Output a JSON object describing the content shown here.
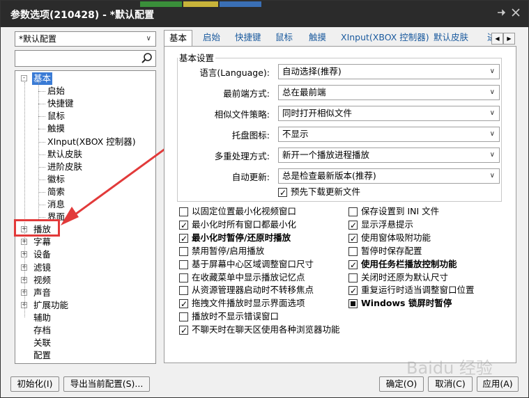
{
  "window": {
    "title": "参数选项(210428) - *默认配置",
    "pin_icon": "pin-icon",
    "close_icon": "close-icon"
  },
  "sidebar": {
    "profile": "*默认配置",
    "search_placeholder": "",
    "tree": [
      {
        "label": "基本",
        "expander": "-",
        "selected": true
      },
      {
        "label": "启始",
        "child": true
      },
      {
        "label": "快捷键",
        "child": true
      },
      {
        "label": "鼠标",
        "child": true
      },
      {
        "label": "触摸",
        "child": true
      },
      {
        "label": "XInput(XBOX 控制器)",
        "child": true
      },
      {
        "label": "默认皮肤",
        "child": true
      },
      {
        "label": "进阶皮肤",
        "child": true
      },
      {
        "label": "徽标",
        "child": true
      },
      {
        "label": "简索",
        "child": true
      },
      {
        "label": "消息",
        "child": true
      },
      {
        "label": "界面",
        "child": true
      },
      {
        "label": "播放",
        "expander": "+"
      },
      {
        "label": "字幕",
        "expander": "+"
      },
      {
        "label": "设备",
        "expander": "+"
      },
      {
        "label": "滤镜",
        "expander": "+"
      },
      {
        "label": "视频",
        "expander": "+"
      },
      {
        "label": "声音",
        "expander": "+"
      },
      {
        "label": "扩展功能",
        "expander": "+"
      },
      {
        "label": "辅助"
      },
      {
        "label": "存档"
      },
      {
        "label": "关联"
      },
      {
        "label": "配置"
      }
    ]
  },
  "tabs": [
    "基本",
    "启始",
    "快捷键",
    "鼠标",
    "触摸",
    "XInput(XBOX 控制器)",
    "默认皮肤",
    "进"
  ],
  "basic": {
    "group_title": "基本设置",
    "fields": [
      {
        "label": "语言(Language):",
        "value": "自动选择(推荐)"
      },
      {
        "label": "最前端方式:",
        "value": "总在最前端"
      },
      {
        "label": "相似文件策略:",
        "value": "同时打开相似文件"
      },
      {
        "label": "托盘图标:",
        "value": "不显示"
      },
      {
        "label": "多重处理方式:",
        "value": "新开一个播放进程播放"
      },
      {
        "label": "自动更新:",
        "value": "总是检查最新版本(推荐)"
      }
    ],
    "predownload": "预先下载更新文件",
    "options_left": [
      {
        "label": "以固定位置最小化视频窗口",
        "checked": false
      },
      {
        "label": "最小化时所有窗口都最小化",
        "checked": true
      },
      {
        "label": "最小化时暂停/还原时播放",
        "checked": true,
        "bold": true
      },
      {
        "label": "禁用暂停/启用播放",
        "checked": false
      },
      {
        "label": "基于屏幕中心区域调整窗口尺寸",
        "checked": false
      },
      {
        "label": "在收藏菜单中显示播放记忆点",
        "checked": false
      },
      {
        "label": "从资源管理器启动时不转移焦点",
        "checked": false
      },
      {
        "label": "拖拽文件播放时显示界面选项",
        "checked": true
      },
      {
        "label": "播放时不显示错误窗口",
        "checked": false
      },
      {
        "label": "不聊天时在聊天区使用各种浏览器功能",
        "checked": true
      }
    ],
    "options_right": [
      {
        "label": "保存设置到 INI 文件",
        "checked": false
      },
      {
        "label": "显示浮悬提示",
        "checked": true
      },
      {
        "label": "使用窗体吸附功能",
        "checked": true
      },
      {
        "label": "暂停时保存配置",
        "checked": false
      },
      {
        "label": "使用任务栏播放控制功能",
        "checked": true,
        "bold": true
      },
      {
        "label": "关闭时还原为默认尺寸",
        "checked": false
      },
      {
        "label": "重复运行时适当调整窗口位置",
        "checked": true
      },
      {
        "label": "Windows 锁屏时暂停",
        "state": "indeterminate",
        "bold": true
      }
    ]
  },
  "footer": {
    "init": "初始化(I)",
    "export": "导出当前配置(S)...",
    "ok": "确定(O)",
    "cancel": "取消(C)",
    "apply": "应用(A)"
  },
  "watermark": "Baidu 经验",
  "colors": {
    "accent": "#3a7bd5",
    "highlight": "#e23a3a",
    "titlebar": "#2b2b2b"
  }
}
